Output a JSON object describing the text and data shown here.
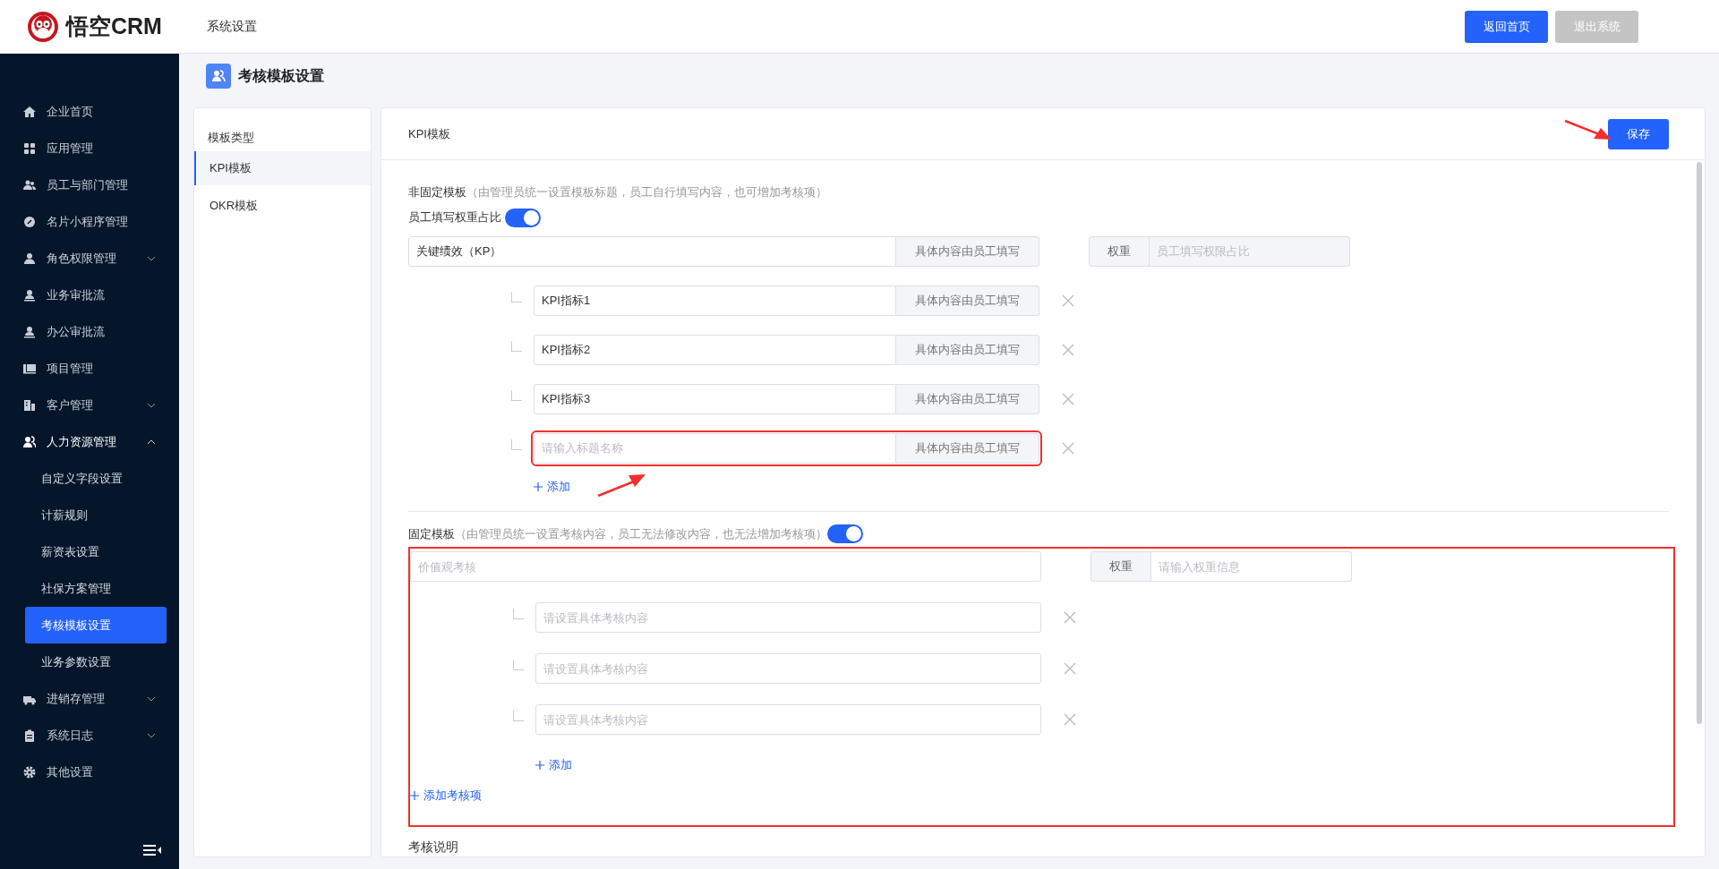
{
  "header": {
    "logo_text": "悟空CRM",
    "title": "系统设置",
    "buttons": [
      {
        "label": "返回首页",
        "disabled": false
      },
      {
        "label": "退出系统",
        "disabled": true
      }
    ]
  },
  "sidebar": {
    "items": [
      {
        "label": "企业首页",
        "kind": "link"
      },
      {
        "label": "应用管理",
        "kind": "link"
      },
      {
        "label": "员工与部门管理",
        "kind": "link"
      },
      {
        "label": "名片小程序管理",
        "kind": "link"
      },
      {
        "label": "角色权限管理",
        "kind": "group",
        "expanded": false
      },
      {
        "label": "业务审批流",
        "kind": "link"
      },
      {
        "label": "办公审批流",
        "kind": "link"
      },
      {
        "label": "项目管理",
        "kind": "link"
      },
      {
        "label": "客户管理",
        "kind": "group",
        "expanded": false
      },
      {
        "label": "人力资源管理",
        "kind": "group",
        "expanded": true,
        "children": [
          {
            "label": "自定义字段设置",
            "selected": false
          },
          {
            "label": "计薪规则",
            "selected": false
          },
          {
            "label": "薪资表设置",
            "selected": false
          },
          {
            "label": "社保方案管理",
            "selected": false
          },
          {
            "label": "考核模板设置",
            "selected": true
          },
          {
            "label": "业务参数设置",
            "selected": false
          }
        ]
      },
      {
        "label": "进销存管理",
        "kind": "group",
        "expanded": false
      },
      {
        "label": "系统日志",
        "kind": "group",
        "expanded": false
      },
      {
        "label": "其他设置",
        "kind": "link"
      }
    ]
  },
  "page_title": "考核模板设置",
  "template_types": {
    "title": "模板类型",
    "items": [
      {
        "label": "KPI模板",
        "selected": true
      },
      {
        "label": "OKR模板",
        "selected": false
      }
    ]
  },
  "panel": {
    "title": "KPI模板",
    "save_button": {
      "label": "保存",
      "annotated": true
    },
    "non_fixed": {
      "title": "非固定模板",
      "note": "（由管理员统一设置模板标题，员工自行填写内容，也可增加考核项）",
      "toggle": {
        "label": "员工填写权重占比",
        "on": true
      },
      "main": {
        "value": "关键绩效（KP）",
        "addon": "具体内容由员工填写"
      },
      "weight": {
        "label": "权重",
        "placeholder": "员工填写权限占比",
        "disabled": true
      },
      "items": [
        {
          "value": "KPI指标1",
          "addon": "具体内容由员工填写",
          "highlighted": false
        },
        {
          "value": "KPI指标2",
          "addon": "具体内容由员工填写",
          "highlighted": false
        },
        {
          "value": "KPI指标3",
          "addon": "具体内容由员工填写",
          "highlighted": false
        },
        {
          "placeholder": "请输入标题名称",
          "addon": "具体内容由员工填写",
          "highlighted": true
        }
      ],
      "add_label": "添加"
    },
    "fixed": {
      "title": "固定模板",
      "note": "（由管理员统一设置考核内容，员工无法修改内容，也无法增加考核项）",
      "toggle": {
        "on": true
      },
      "highlighted": true,
      "main": {
        "placeholder": "价值观考核"
      },
      "weight": {
        "label": "权重",
        "placeholder": "请输入权重信息",
        "disabled": false
      },
      "items": [
        {
          "placeholder": "请设置具体考核内容"
        },
        {
          "placeholder": "请设置具体考核内容"
        },
        {
          "placeholder": "请设置具体考核内容"
        }
      ],
      "add_label": "添加",
      "add_item_label": "添加考核项"
    },
    "footer_title": "考核说明"
  }
}
